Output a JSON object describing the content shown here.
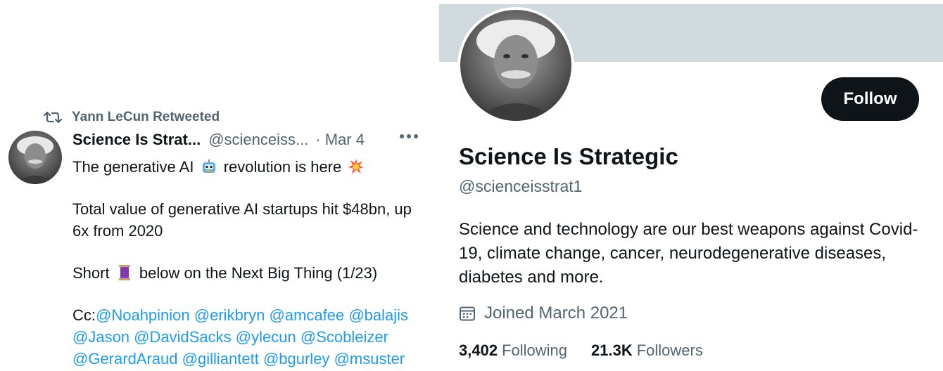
{
  "colors": {
    "text": "#0f1419",
    "muted": "#536471",
    "link": "#1d9bf0",
    "banner": "#cfd9de",
    "button": "#0f1419"
  },
  "tweet": {
    "retweet_label": "Yann LeCun Retweeted",
    "author_name": "Science Is Strat...",
    "author_handle": "@scienceiss...",
    "separator": "·",
    "date": "Mar 4",
    "line1_a": "The generative AI",
    "line1_b": "revolution is here",
    "para2": "Total value of generative AI startups hit $48bn, up 6x from 2020",
    "para3_a": "Short",
    "para3_b": "below on the Next Big Thing (1/23)",
    "cc_prefix": "Cc:",
    "mentions": [
      "@Noahpinion",
      "@erikbryn",
      "@amcafee",
      "@balajis",
      "@Jason",
      "@DavidSacks",
      "@ylecun",
      "@Scobleizer",
      "@GerardAraud",
      "@gilliantett",
      "@bgurley",
      "@msuster"
    ],
    "icons": [
      "retweet-icon",
      "robot-emoji",
      "collision-emoji",
      "thread-spool-emoji",
      "more-icon"
    ]
  },
  "profile": {
    "follow_label": "Follow",
    "display_name": "Science Is Strategic",
    "handle": "@scienceisstrat1",
    "bio": "Science and technology are our best weapons against Covid-19, climate change, cancer, neurodegenerative diseases, diabetes and more.",
    "joined": "Joined March 2021",
    "following_count": "3,402",
    "following_label": "Following",
    "followers_count": "21.3K",
    "followers_label": "Followers",
    "icons": [
      "calendar-icon"
    ]
  }
}
